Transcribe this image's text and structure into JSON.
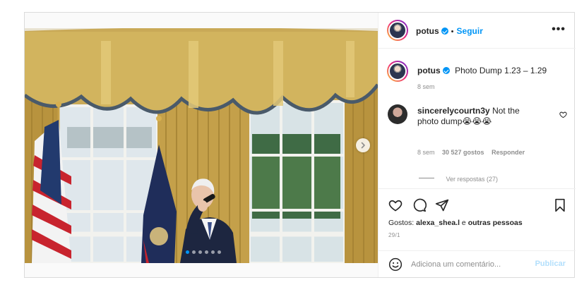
{
  "post": {
    "author": "potus",
    "follow_label": "Seguir",
    "separator": "•",
    "more_label": "•••",
    "caption": "Photo Dump 1.23 – 1.29",
    "caption_age": "8 sem",
    "carousel": {
      "slide_count": 6,
      "active_slide": 1
    }
  },
  "comments": [
    {
      "username": "sincerelycourtn3y",
      "text": "Not the photo dump😭😭😭",
      "age": "8 sem",
      "likes": "30 527 gostos",
      "reply_label": "Responder",
      "view_replies": "Ver respostas (27)"
    }
  ],
  "footer": {
    "likes_prefix": "Gostos:",
    "liked_by": "alexa_shea.l",
    "likes_joiner": "e",
    "likes_others": "outras pessoas",
    "date": "29/1"
  },
  "add_comment": {
    "placeholder": "Adiciona um comentário...",
    "publish_label": "Publicar"
  },
  "colors": {
    "accent": "#0095f6",
    "publish_disabled": "#b2dffc",
    "muted": "#8e8e8e"
  }
}
